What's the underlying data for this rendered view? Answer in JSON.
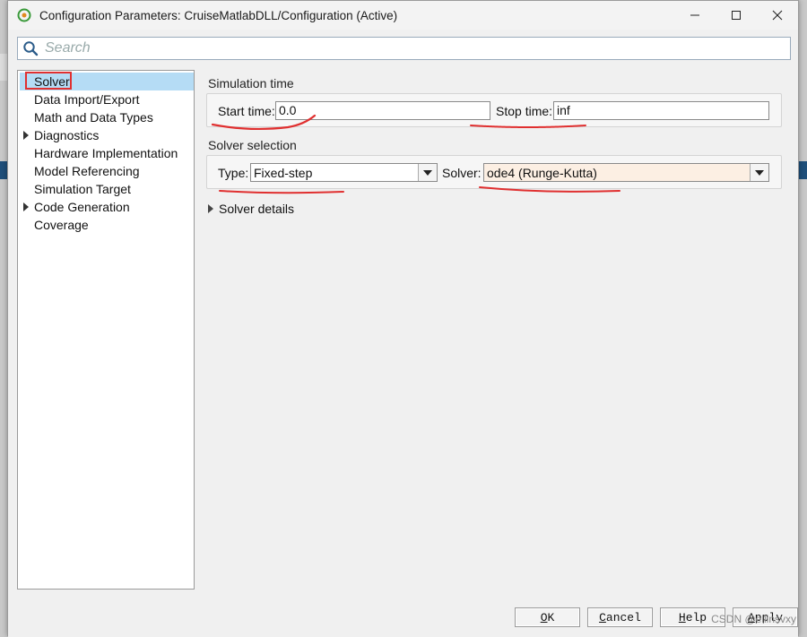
{
  "window": {
    "title": "Configuration Parameters: CruiseMatlabDLL/Configuration (Active)"
  },
  "search": {
    "placeholder": "Search"
  },
  "sidebar": {
    "items": [
      {
        "label": "Solver",
        "selected": true,
        "expandable": false
      },
      {
        "label": "Data Import/Export",
        "expandable": false
      },
      {
        "label": "Math and Data Types",
        "expandable": false
      },
      {
        "label": "Diagnostics",
        "expandable": true
      },
      {
        "label": "Hardware Implementation",
        "expandable": false
      },
      {
        "label": "Model Referencing",
        "expandable": false
      },
      {
        "label": "Simulation Target",
        "expandable": false
      },
      {
        "label": "Code Generation",
        "expandable": true
      },
      {
        "label": "Coverage",
        "expandable": false
      }
    ]
  },
  "simulation_time": {
    "title": "Simulation time",
    "start_label": "Start time:",
    "start_value": "0.0",
    "stop_label": "Stop time:",
    "stop_value": "inf"
  },
  "solver_selection": {
    "title": "Solver selection",
    "type_label": "Type:",
    "type_value": "Fixed-step",
    "solver_label": "Solver:",
    "solver_value": "ode4 (Runge-Kutta)"
  },
  "solver_details": {
    "label": "Solver details"
  },
  "buttons": {
    "ok_first": "O",
    "ok_rest": "K",
    "cancel_first": "C",
    "cancel_rest": "ancel",
    "help_first": "H",
    "help_rest": "elp",
    "apply_first": "A",
    "apply_rest": "pply"
  },
  "watermark": "CSDN @ellinsvxy",
  "colors": {
    "selection": "#b5dcf5",
    "annotation": "#e03030",
    "solver_field": "#fcefe3"
  },
  "icons": [
    "simulink-app-icon",
    "minimize-icon",
    "maximize-icon",
    "close-icon",
    "search-icon"
  ]
}
